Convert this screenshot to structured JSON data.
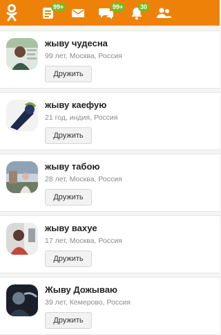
{
  "topbar": {
    "color": "#ee8208",
    "icons": [
      {
        "name": "ok-logo-icon"
      },
      {
        "name": "feed-icon",
        "badge": "99+"
      },
      {
        "name": "messages-icon"
      },
      {
        "name": "discussions-icon",
        "badge": "99+"
      },
      {
        "name": "notifications-icon",
        "badge": "30"
      },
      {
        "name": "friends-icon"
      }
    ],
    "badge_color": "#7ab820"
  },
  "people": [
    {
      "name": "жыву чудесна",
      "info": "99 лет, Москва, Россия",
      "button": "Дружить"
    },
    {
      "name": "жыву каефую",
      "info": "21 год, индия, Россия",
      "button": "Дружить"
    },
    {
      "name": "жыву табою",
      "info": "28 лет, Москва, Россия",
      "button": "Дружить"
    },
    {
      "name": "жыву вахуе",
      "info": "17 лет, Москва, Россия",
      "button": "Дружить"
    },
    {
      "name": "Жыву Дожываю",
      "info": "39 лет, Кемерово, Россия",
      "button": "Дружить"
    }
  ]
}
